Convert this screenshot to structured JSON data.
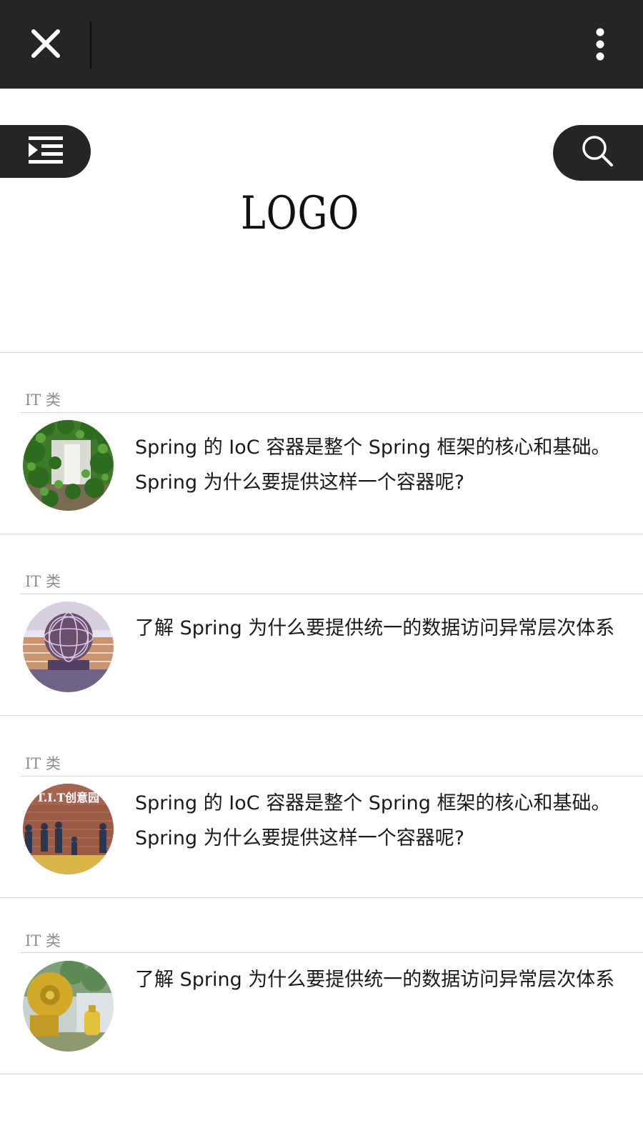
{
  "topbar": {
    "close_icon": "close-icon",
    "more_icon": "more-vertical-icon"
  },
  "header": {
    "menu_icon": "menu-indent-icon",
    "search_icon": "search-icon",
    "logo": "LOGO"
  },
  "articles": [
    {
      "category": "IT 类",
      "title_line1": "Spring 的 IoC 容器是整个 Spring 框架的核心和基础。",
      "title_line2": "Spring 为什么要提供这样一个容器呢?",
      "thumbnail": "ivy-wall-photo"
    },
    {
      "category": "IT 类",
      "title_line1": "了解 Spring 为什么要提供统一的数据访问异常层次体系",
      "title_line2": "",
      "thumbnail": "metal-sphere-sculpture-photo"
    },
    {
      "category": "IT 类",
      "title_line1": "Spring 的 IoC 容器是整个 Spring 框架的核心和基础。",
      "title_line2": "Spring 为什么要提供这样一个容器呢?",
      "thumbnail": "creative-park-statues-photo",
      "thumbnail_text": "T.I.T创意园"
    },
    {
      "category": "IT 类",
      "title_line1": "了解 Spring 为什么要提供统一的数据访问异常层次体系",
      "title_line2": "",
      "thumbnail": "yellow-machine-sculpture-photo"
    }
  ]
}
